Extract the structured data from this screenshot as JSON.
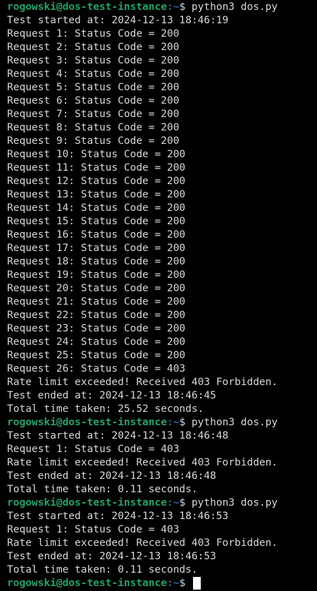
{
  "prompt": {
    "user_host": "rogowski@dos-test-instance",
    "path": ":~",
    "symbol": "$ "
  },
  "colors": {
    "background": "#000000",
    "text": "#d8d8d8",
    "prompt_user": "#26a269",
    "prompt_path": "#3465a4",
    "cursor": "#ffffff"
  },
  "lines": [
    {
      "type": "prompt",
      "command": "python3 dos.py"
    },
    {
      "type": "output",
      "text": "Test started at: 2024-12-13 18:46:19"
    },
    {
      "type": "output",
      "text": "Request 1: Status Code = 200"
    },
    {
      "type": "output",
      "text": "Request 2: Status Code = 200"
    },
    {
      "type": "output",
      "text": "Request 3: Status Code = 200"
    },
    {
      "type": "output",
      "text": "Request 4: Status Code = 200"
    },
    {
      "type": "output",
      "text": "Request 5: Status Code = 200"
    },
    {
      "type": "output",
      "text": "Request 6: Status Code = 200"
    },
    {
      "type": "output",
      "text": "Request 7: Status Code = 200"
    },
    {
      "type": "output",
      "text": "Request 8: Status Code = 200"
    },
    {
      "type": "output",
      "text": "Request 9: Status Code = 200"
    },
    {
      "type": "output",
      "text": "Request 10: Status Code = 200"
    },
    {
      "type": "output",
      "text": "Request 11: Status Code = 200"
    },
    {
      "type": "output",
      "text": "Request 12: Status Code = 200"
    },
    {
      "type": "output",
      "text": "Request 13: Status Code = 200"
    },
    {
      "type": "output",
      "text": "Request 14: Status Code = 200"
    },
    {
      "type": "output",
      "text": "Request 15: Status Code = 200"
    },
    {
      "type": "output",
      "text": "Request 16: Status Code = 200"
    },
    {
      "type": "output",
      "text": "Request 17: Status Code = 200"
    },
    {
      "type": "output",
      "text": "Request 18: Status Code = 200"
    },
    {
      "type": "output",
      "text": "Request 19: Status Code = 200"
    },
    {
      "type": "output",
      "text": "Request 20: Status Code = 200"
    },
    {
      "type": "output",
      "text": "Request 21: Status Code = 200"
    },
    {
      "type": "output",
      "text": "Request 22: Status Code = 200"
    },
    {
      "type": "output",
      "text": "Request 23: Status Code = 200"
    },
    {
      "type": "output",
      "text": "Request 24: Status Code = 200"
    },
    {
      "type": "output",
      "text": "Request 25: Status Code = 200"
    },
    {
      "type": "output",
      "text": "Request 26: Status Code = 403"
    },
    {
      "type": "output",
      "text": "Rate limit exceeded! Received 403 Forbidden."
    },
    {
      "type": "output",
      "text": "Test ended at: 2024-12-13 18:46:45"
    },
    {
      "type": "output",
      "text": "Total time taken: 25.52 seconds."
    },
    {
      "type": "prompt",
      "command": "python3 dos.py"
    },
    {
      "type": "output",
      "text": "Test started at: 2024-12-13 18:46:48"
    },
    {
      "type": "output",
      "text": "Request 1: Status Code = 403"
    },
    {
      "type": "output",
      "text": "Rate limit exceeded! Received 403 Forbidden."
    },
    {
      "type": "output",
      "text": "Test ended at: 2024-12-13 18:46:48"
    },
    {
      "type": "output",
      "text": "Total time taken: 0.11 seconds."
    },
    {
      "type": "prompt",
      "command": "python3 dos.py"
    },
    {
      "type": "output",
      "text": "Test started at: 2024-12-13 18:46:53"
    },
    {
      "type": "output",
      "text": "Request 1: Status Code = 403"
    },
    {
      "type": "output",
      "text": "Rate limit exceeded! Received 403 Forbidden."
    },
    {
      "type": "output",
      "text": "Test ended at: 2024-12-13 18:46:53"
    },
    {
      "type": "output",
      "text": "Total time taken: 0.11 seconds."
    },
    {
      "type": "prompt",
      "command": "",
      "cursor": true
    }
  ]
}
